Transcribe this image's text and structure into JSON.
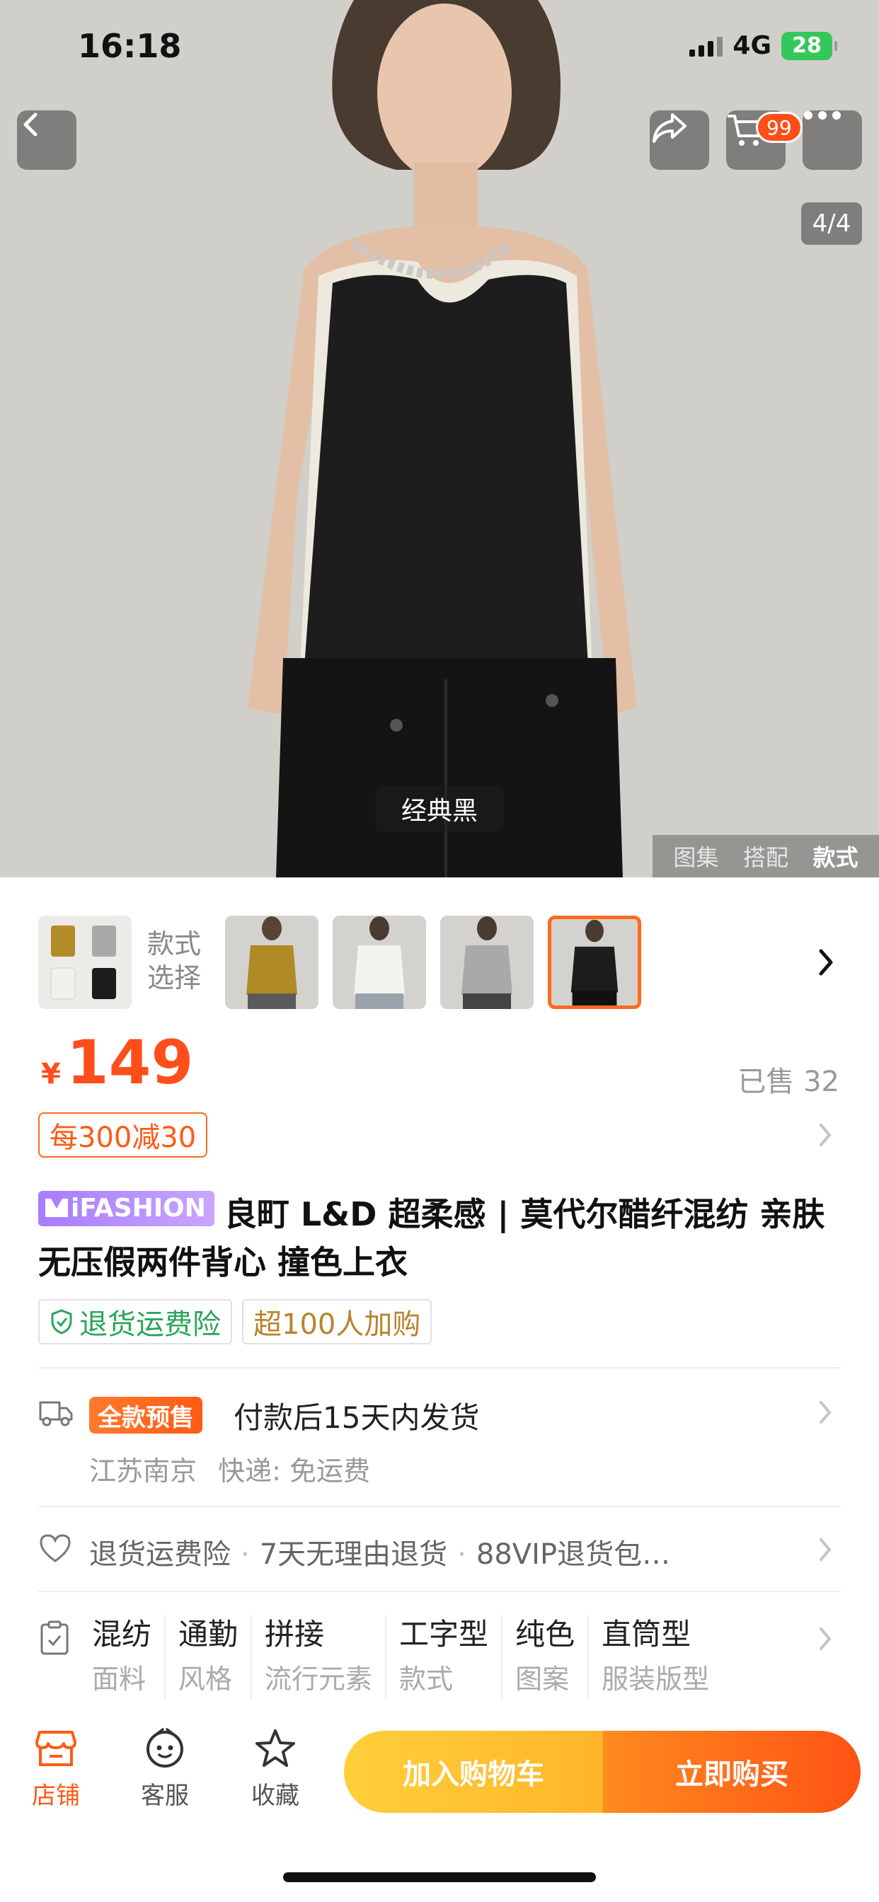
{
  "status": {
    "time": "16:18",
    "network": "4G",
    "battery": "28"
  },
  "gallery": {
    "counter": "4/4",
    "variant_label": "经典黑",
    "tabs": [
      "图集",
      "搭配",
      "款式"
    ],
    "active_tab": "款式"
  },
  "header": {
    "cart_badge": "99"
  },
  "style_selector": {
    "label_line1": "款式",
    "label_line2": "选择"
  },
  "price": {
    "currency": "¥",
    "value": "149",
    "sold": "已售 32"
  },
  "coupon": {
    "text": "每300减30"
  },
  "product": {
    "brand_tag": "iFASHION",
    "title": "良町 L&D 超柔感 | 莫代尔醋纤混纺 亲肤无压假两件背心 撞色上衣",
    "tags": [
      "退货运费险",
      "超100人加购"
    ]
  },
  "shipping": {
    "presale_badge": "全款预售",
    "text": "付款后15天内发货",
    "origin": "江苏南京",
    "method": "快递: 免运费"
  },
  "services": {
    "items": [
      "退货运费险",
      "7天无理由退货",
      "88VIP退货包…"
    ]
  },
  "attributes": [
    {
      "value": "混纺",
      "key": "面料"
    },
    {
      "value": "通勤",
      "key": "风格"
    },
    {
      "value": "拼接",
      "key": "流行元素"
    },
    {
      "value": "工字型",
      "key": "款式"
    },
    {
      "value": "纯色",
      "key": "图案"
    },
    {
      "value": "直筒型",
      "key": "服装版型"
    }
  ],
  "bottom": {
    "store": "店铺",
    "service": "客服",
    "favorite": "收藏",
    "add_to_cart": "加入购物车",
    "buy_now": "立即购买"
  },
  "colors": {
    "accent": "#ff5a14",
    "cart_button": "#ffc22e",
    "badge_green": "#35c759"
  }
}
